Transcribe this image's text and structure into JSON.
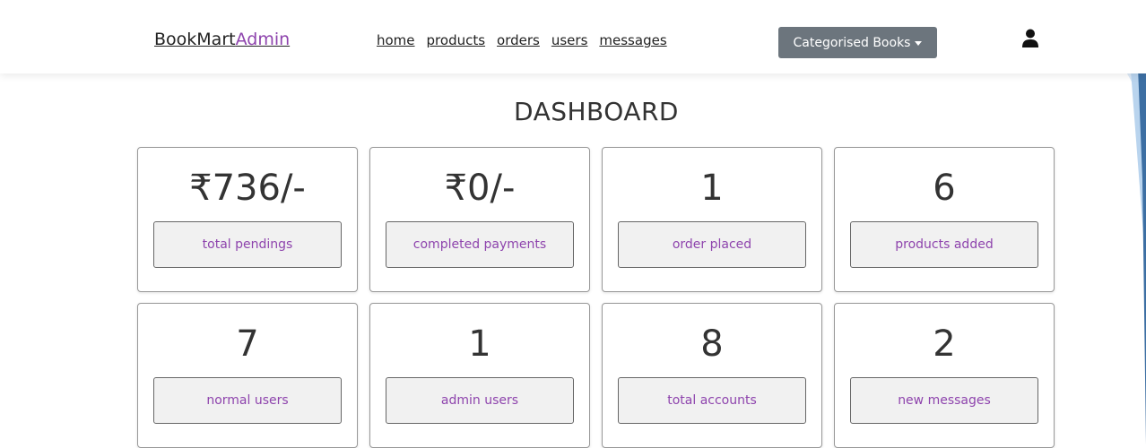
{
  "navbar": {
    "brand_main": "BookMart",
    "brand_accent": "Admin",
    "links": [
      "home",
      "products",
      "orders",
      "users",
      "messages"
    ],
    "dropdown_label": "Categorised Books",
    "user_icon": "user-icon"
  },
  "dashboard": {
    "title": "DASHBOARD",
    "cards": [
      {
        "value": "₹736/-",
        "label": "total pendings"
      },
      {
        "value": "₹0/-",
        "label": "completed payments"
      },
      {
        "value": "1",
        "label": "order placed"
      },
      {
        "value": "6",
        "label": "products added"
      },
      {
        "value": "7",
        "label": "normal users"
      },
      {
        "value": "1",
        "label": "admin users"
      },
      {
        "value": "8",
        "label": "total accounts"
      },
      {
        "value": "2",
        "label": "new messages"
      }
    ]
  },
  "colors": {
    "accent": "#8e44ad",
    "dropdown_bg": "#6c757d"
  }
}
